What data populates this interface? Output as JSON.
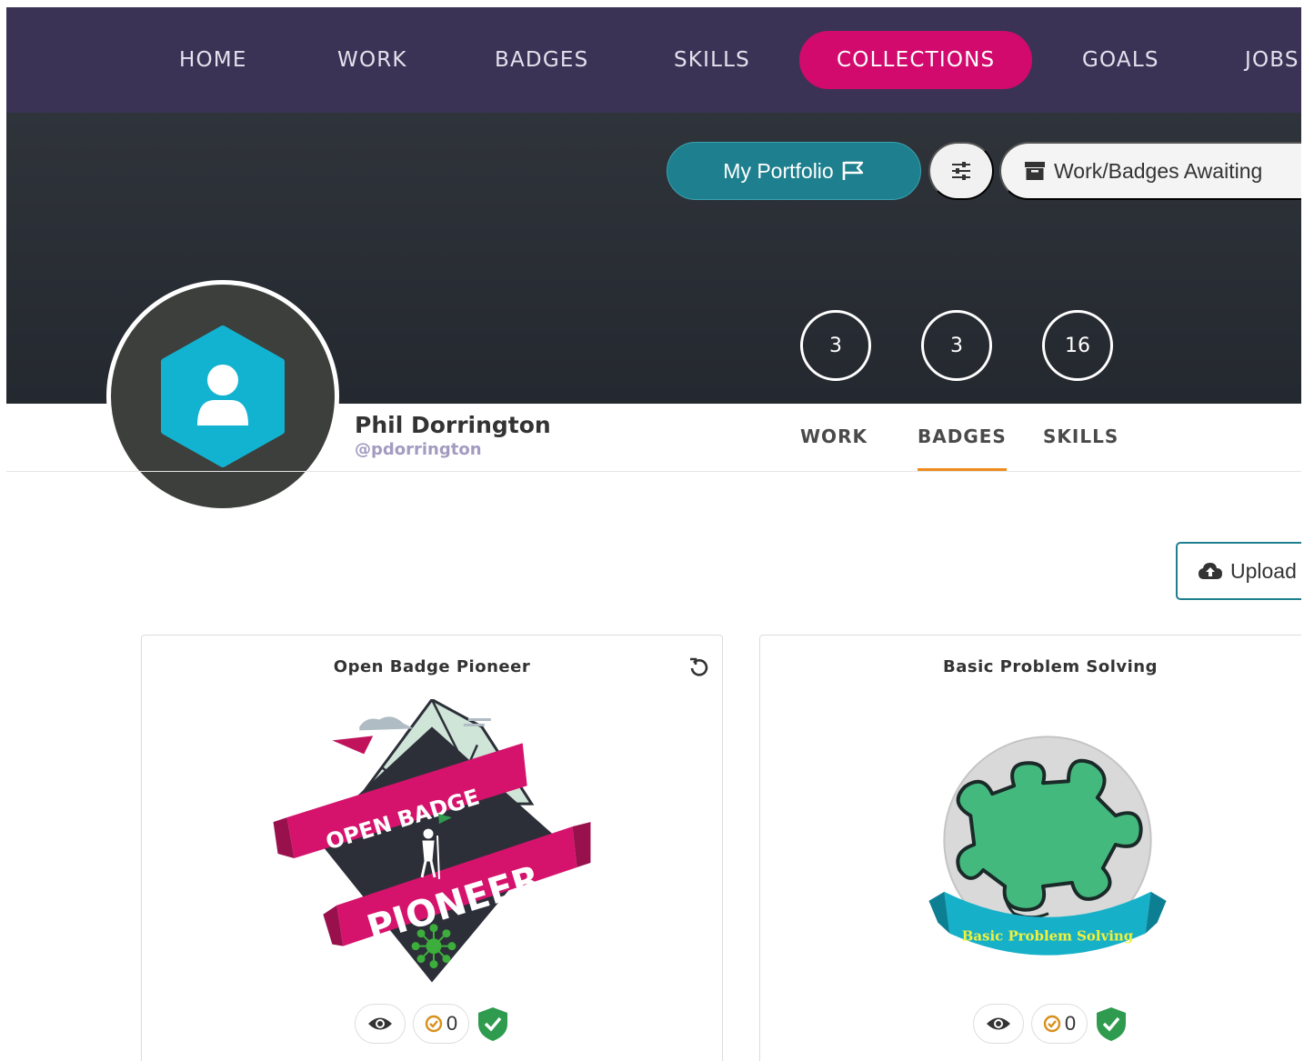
{
  "nav": {
    "items": [
      {
        "label": "HOME"
      },
      {
        "label": "WORK"
      },
      {
        "label": "BADGES"
      },
      {
        "label": "SKILLS"
      },
      {
        "label": "COLLECTIONS",
        "active": true
      },
      {
        "label": "GOALS"
      },
      {
        "label": "JOBS"
      }
    ],
    "active_color": "#d20a6e",
    "background": "#3b3355"
  },
  "hero": {
    "portfolio_label": "My Portfolio",
    "awaiting_label": "Work/Badges Awaiting",
    "stats": [
      "3",
      "3",
      "16"
    ]
  },
  "profile": {
    "name": "Phil Dorrington",
    "handle": "@pdorrington",
    "tabs": [
      {
        "label": "WORK"
      },
      {
        "label": "BADGES",
        "active": true
      },
      {
        "label": "SKILLS"
      }
    ]
  },
  "upload": {
    "label": "Upload"
  },
  "badges": [
    {
      "title": "Open Badge Pioneer",
      "ribbon_top": "OPEN BADGE",
      "ribbon_bottom": "PIONEER",
      "endorsements": "0",
      "verified": true
    },
    {
      "title": "Basic Problem Solving",
      "ribbon_text": "Basic Problem Solving",
      "endorsements": "0",
      "verified": true
    }
  ],
  "colors": {
    "accent_teal": "#1e7f8f",
    "tab_underline": "#f08c1e",
    "verified_green": "#2e9b4e"
  }
}
